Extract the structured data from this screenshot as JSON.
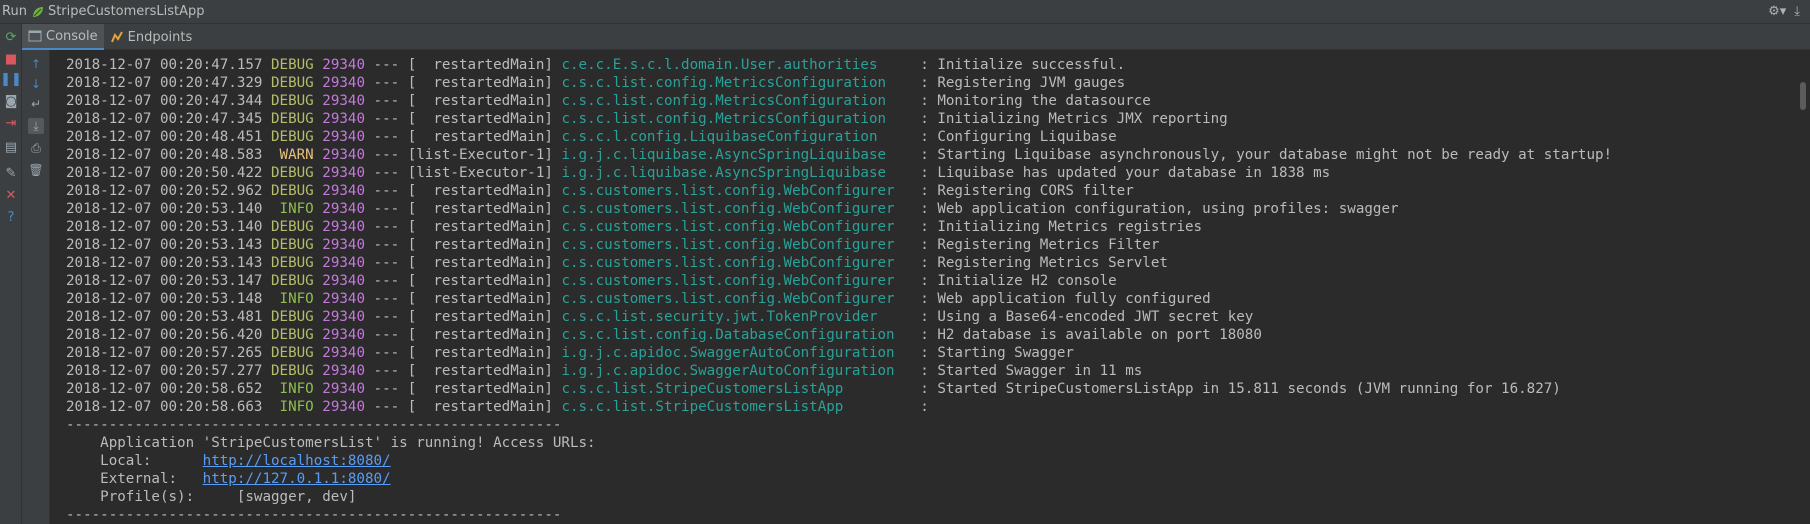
{
  "titlebar": {
    "run_label": "Run",
    "app_name": "StripeCustomersListApp"
  },
  "tabs": [
    {
      "label": "Console",
      "icon": "console-icon",
      "active": true
    },
    {
      "label": "Endpoints",
      "icon": "endpoints-icon",
      "active": false
    }
  ],
  "left_toolbar": [
    "rerun-icon",
    "stop-icon",
    "pause-icon",
    "camera-icon",
    "login-icon",
    "layout-icon",
    "pin-icon",
    "close-icon",
    "help-icon"
  ],
  "inner_toolbar": [
    "up-arrow-icon",
    "down-arrow-icon",
    "soft-wrap-icon",
    "scroll-to-end-icon",
    "print-icon",
    "trash-icon"
  ],
  "log": [
    {
      "ts": "2018-12-07 00:20:47.157",
      "level": "DEBUG",
      "pid": "29340",
      "thread": "  restartedMain",
      "logger": "c.e.c.E.s.c.l.domain.User.authorities    ",
      "msg": "Initialize successful."
    },
    {
      "ts": "2018-12-07 00:20:47.329",
      "level": "DEBUG",
      "pid": "29340",
      "thread": "  restartedMain",
      "logger": "c.s.c.list.config.MetricsConfiguration   ",
      "msg": "Registering JVM gauges"
    },
    {
      "ts": "2018-12-07 00:20:47.344",
      "level": "DEBUG",
      "pid": "29340",
      "thread": "  restartedMain",
      "logger": "c.s.c.list.config.MetricsConfiguration   ",
      "msg": "Monitoring the datasource"
    },
    {
      "ts": "2018-12-07 00:20:47.345",
      "level": "DEBUG",
      "pid": "29340",
      "thread": "  restartedMain",
      "logger": "c.s.c.list.config.MetricsConfiguration   ",
      "msg": "Initializing Metrics JMX reporting"
    },
    {
      "ts": "2018-12-07 00:20:48.451",
      "level": "DEBUG",
      "pid": "29340",
      "thread": "  restartedMain",
      "logger": "c.s.c.l.config.LiquibaseConfiguration    ",
      "msg": "Configuring Liquibase"
    },
    {
      "ts": "2018-12-07 00:20:48.583",
      "level": " WARN",
      "pid": "29340",
      "thread": "list-Executor-1",
      "logger": "i.g.j.c.liquibase.AsyncSpringLiquibase   ",
      "msg": "Starting Liquibase asynchronously, your database might not be ready at startup!"
    },
    {
      "ts": "2018-12-07 00:20:50.422",
      "level": "DEBUG",
      "pid": "29340",
      "thread": "list-Executor-1",
      "logger": "i.g.j.c.liquibase.AsyncSpringLiquibase   ",
      "msg": "Liquibase has updated your database in 1838 ms"
    },
    {
      "ts": "2018-12-07 00:20:52.962",
      "level": "DEBUG",
      "pid": "29340",
      "thread": "  restartedMain",
      "logger": "c.s.customers.list.config.WebConfigurer  ",
      "msg": "Registering CORS filter"
    },
    {
      "ts": "2018-12-07 00:20:53.140",
      "level": " INFO",
      "pid": "29340",
      "thread": "  restartedMain",
      "logger": "c.s.customers.list.config.WebConfigurer  ",
      "msg": "Web application configuration, using profiles: swagger"
    },
    {
      "ts": "2018-12-07 00:20:53.140",
      "level": "DEBUG",
      "pid": "29340",
      "thread": "  restartedMain",
      "logger": "c.s.customers.list.config.WebConfigurer  ",
      "msg": "Initializing Metrics registries"
    },
    {
      "ts": "2018-12-07 00:20:53.143",
      "level": "DEBUG",
      "pid": "29340",
      "thread": "  restartedMain",
      "logger": "c.s.customers.list.config.WebConfigurer  ",
      "msg": "Registering Metrics Filter"
    },
    {
      "ts": "2018-12-07 00:20:53.143",
      "level": "DEBUG",
      "pid": "29340",
      "thread": "  restartedMain",
      "logger": "c.s.customers.list.config.WebConfigurer  ",
      "msg": "Registering Metrics Servlet"
    },
    {
      "ts": "2018-12-07 00:20:53.147",
      "level": "DEBUG",
      "pid": "29340",
      "thread": "  restartedMain",
      "logger": "c.s.customers.list.config.WebConfigurer  ",
      "msg": "Initialize H2 console"
    },
    {
      "ts": "2018-12-07 00:20:53.148",
      "level": " INFO",
      "pid": "29340",
      "thread": "  restartedMain",
      "logger": "c.s.customers.list.config.WebConfigurer  ",
      "msg": "Web application fully configured"
    },
    {
      "ts": "2018-12-07 00:20:53.481",
      "level": "DEBUG",
      "pid": "29340",
      "thread": "  restartedMain",
      "logger": "c.s.c.list.security.jwt.TokenProvider    ",
      "msg": "Using a Base64-encoded JWT secret key"
    },
    {
      "ts": "2018-12-07 00:20:56.420",
      "level": "DEBUG",
      "pid": "29340",
      "thread": "  restartedMain",
      "logger": "c.s.c.list.config.DatabaseConfiguration  ",
      "msg": "H2 database is available on port 18080"
    },
    {
      "ts": "2018-12-07 00:20:57.265",
      "level": "DEBUG",
      "pid": "29340",
      "thread": "  restartedMain",
      "logger": "i.g.j.c.apidoc.SwaggerAutoConfiguration  ",
      "msg": "Starting Swagger"
    },
    {
      "ts": "2018-12-07 00:20:57.277",
      "level": "DEBUG",
      "pid": "29340",
      "thread": "  restartedMain",
      "logger": "i.g.j.c.apidoc.SwaggerAutoConfiguration  ",
      "msg": "Started Swagger in 11 ms"
    },
    {
      "ts": "2018-12-07 00:20:58.652",
      "level": " INFO",
      "pid": "29340",
      "thread": "  restartedMain",
      "logger": "c.s.c.list.StripeCustomersListApp        ",
      "msg": "Started StripeCustomersListApp in 15.811 seconds (JVM running for 16.827)"
    },
    {
      "ts": "2018-12-07 00:20:58.663",
      "level": " INFO",
      "pid": "29340",
      "thread": "  restartedMain",
      "logger": "c.s.c.list.StripeCustomersListApp        ",
      "msg": ""
    }
  ],
  "separator": "----------------------------------------------------------",
  "banner": {
    "running": "    Application 'StripeCustomersList' is running! Access URLs:",
    "local_label": "    Local:      ",
    "local_url": "http://localhost:8080/",
    "external_label": "    External:   ",
    "external_url": "http://127.0.1.1:8080/",
    "profiles_label": "    Profile(s): ",
    "profiles_value": "    [swagger, dev]"
  },
  "colors": {
    "background": "#2b2b2b",
    "panel": "#3c3f41",
    "logger": "#2aa198",
    "debug": "#b5bd68",
    "info": "#8fbf4d",
    "warn": "#e5c07b",
    "pid": "#c678dd",
    "link": "#589df6"
  }
}
